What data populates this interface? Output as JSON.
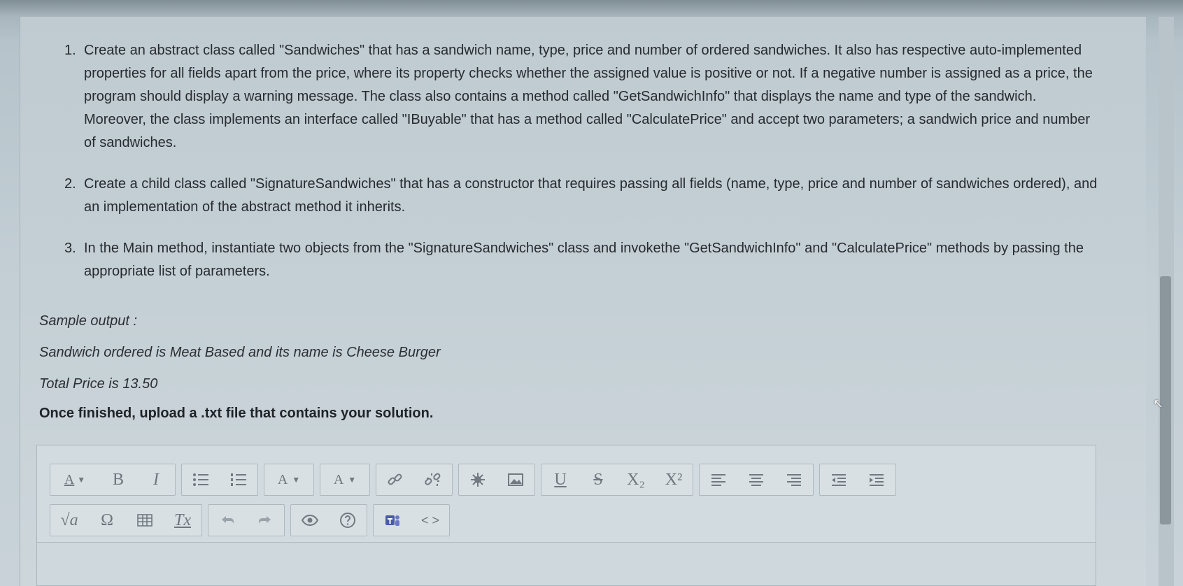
{
  "tasks": [
    {
      "num": "1.",
      "text": "Create an abstract class called \"Sandwiches\" that has a sandwich name, type, price and number of ordered sandwiches. It also has respective auto-implemented properties for all fields apart from the price, where its property checks whether the assigned value is positive or not. If a negative number is assigned as a price, the program should display a warning message. The class also contains a method called \"GetSandwichInfo\" that displays the name and type of the sandwich. Moreover, the class implements an interface called \"IBuyable\" that has a method called \"CalculatePrice\" and accept two parameters; a sandwich price and number of sandwiches."
    },
    {
      "num": "2.",
      "text": "Create a child class called \"SignatureSandwiches\" that has a constructor that requires passing all fields (name, type, price and number of sandwiches ordered), and an implementation of the abstract method it inherits."
    },
    {
      "num": "3.",
      "text": "In the Main method, instantiate two objects from the \"SignatureSandwiches\" class and invokethe \"GetSandwichInfo\" and \"CalculatePrice\" methods by passing the appropriate list of parameters."
    }
  ],
  "sample": {
    "heading": "Sample output :",
    "line1": "Sandwich ordered is Meat Based and its name is Cheese Burger",
    "line2": "Total Price is 13.50"
  },
  "instruction": "Once finished, upload a .txt file that contains your solution.",
  "toolbar": {
    "bold": "B",
    "italic": "I",
    "text_color": "A",
    "bg_color": "A",
    "underline": "U",
    "strike": "S",
    "subscript": "X₂",
    "superscript": "X²",
    "formula": "√a",
    "special_char": "Ω",
    "clear_format": "Tx",
    "source": "< >",
    "font_size": "A"
  }
}
